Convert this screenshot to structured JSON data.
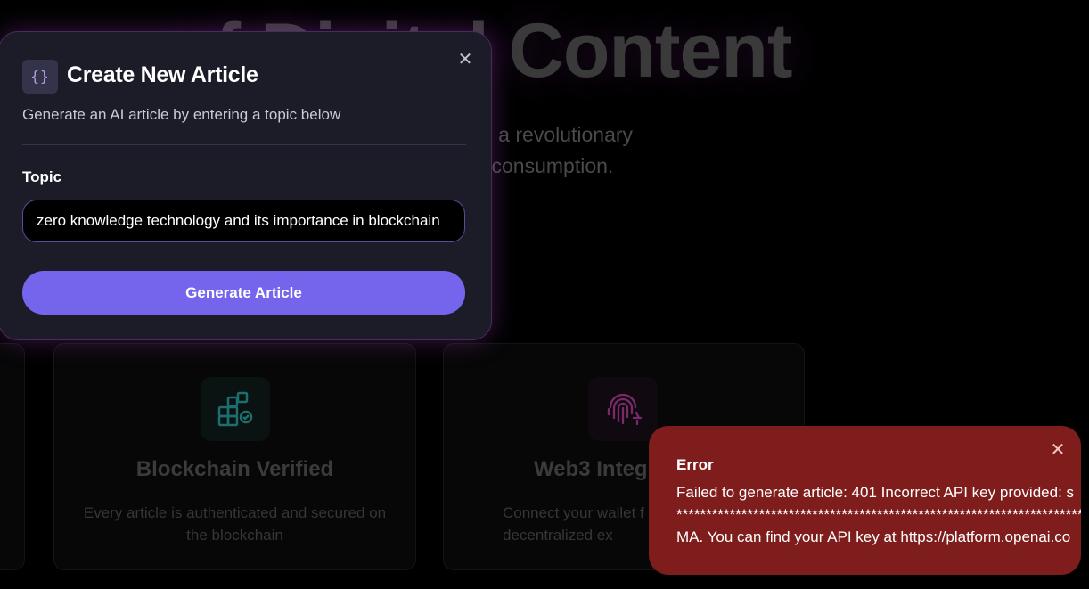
{
  "hero": {
    "title": "of Digital Content",
    "subtitle_line1": "e a revolutionary",
    "subtitle_line2": "l consumption."
  },
  "features": [
    {
      "icon": "blocks-icon",
      "title": "Blockchain Verified",
      "description": "Every article is authenticated and secured on the blockchain"
    },
    {
      "icon": "fingerprint-icon",
      "title": "Web3 Integ",
      "description": "Connect your wallet f decentralized ex"
    }
  ],
  "modal": {
    "icon_glyph": "{}",
    "title": "Create New Article",
    "subtitle": "Generate an AI article by entering a topic below",
    "close_glyph": "✕",
    "topic_label": "Topic",
    "topic_value": "zero knowledge technology and its importance in blockchain",
    "generate_label": "Generate Article"
  },
  "toast": {
    "close_glyph": "✕",
    "title": "Error",
    "message_line1": "Failed to generate article: 401 Incorrect API key provided: s",
    "message_line2": "*************************************************************************",
    "message_line3": "MA. You can find your API key at https://platform.openai.co"
  },
  "colors": {
    "accent": "#7565ec",
    "error_bg": "#7f1d1d",
    "modal_bg": "#1c1c28",
    "teal_icon": "#1d6f6f",
    "pink_icon": "#7a2a6a"
  }
}
